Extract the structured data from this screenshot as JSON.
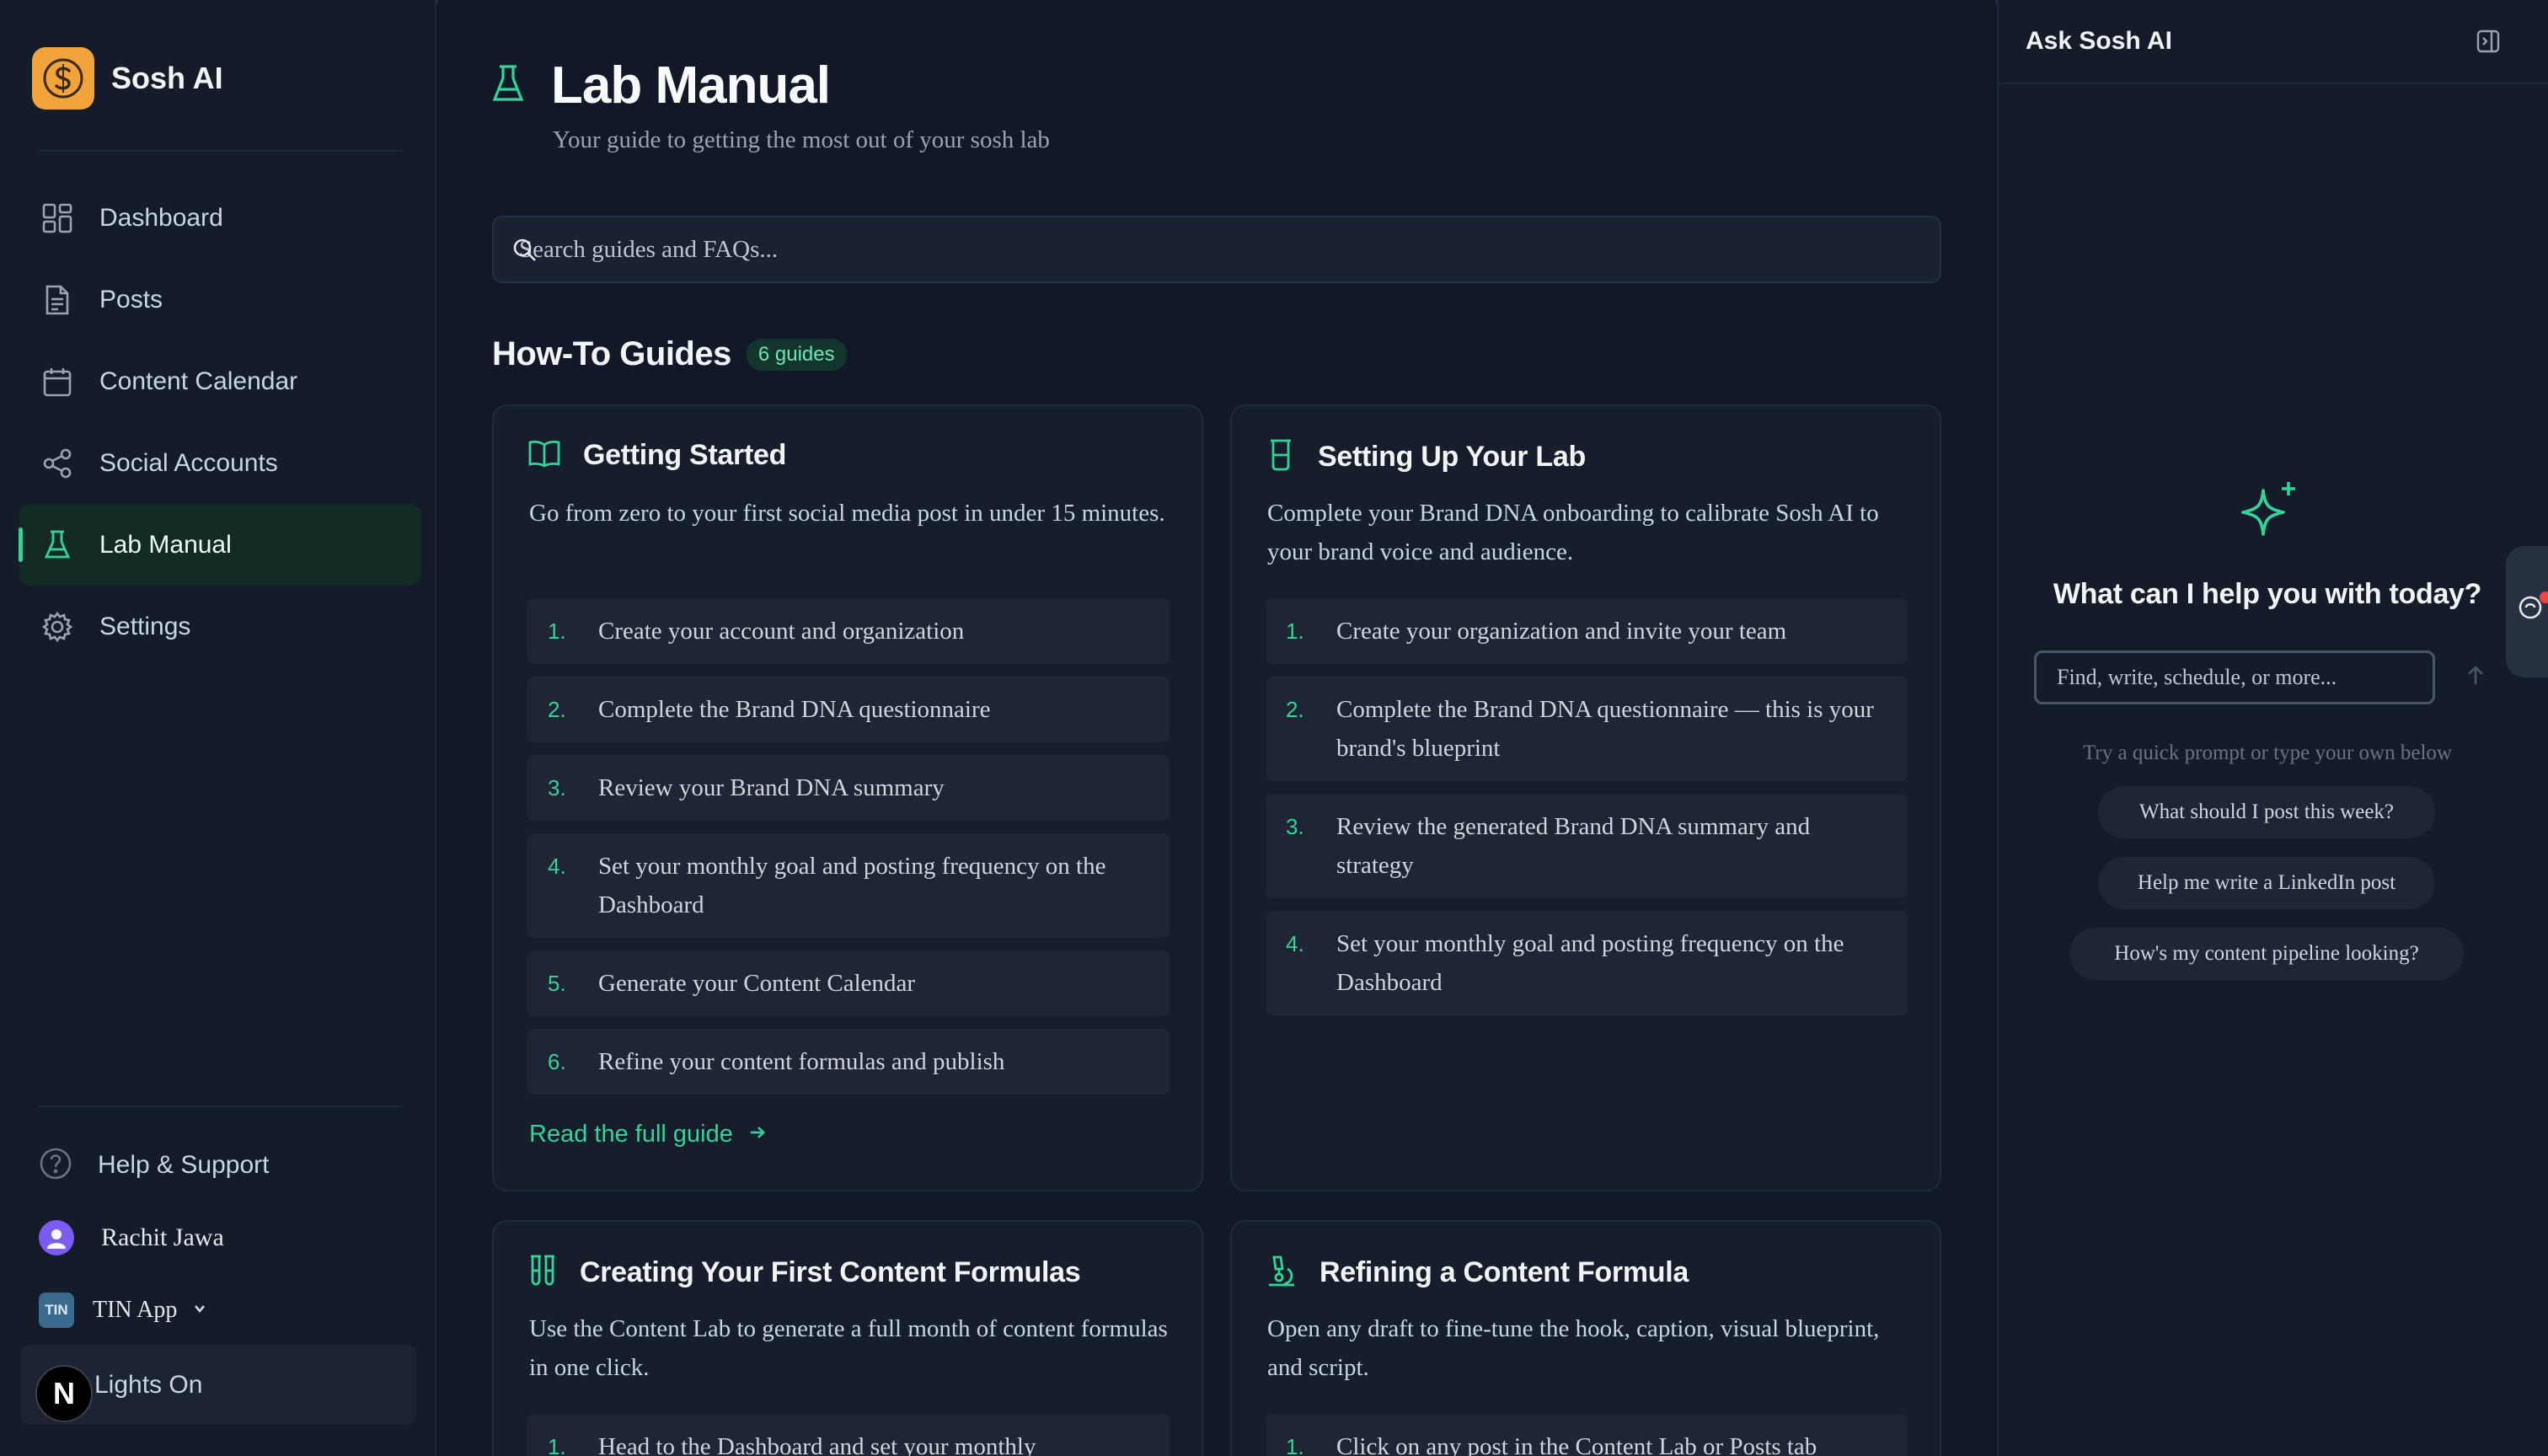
{
  "app": {
    "name": "Sosh AI"
  },
  "sidebar": {
    "nav": [
      {
        "label": "Dashboard",
        "icon": "dashboard-icon"
      },
      {
        "label": "Posts",
        "icon": "document-icon"
      },
      {
        "label": "Content Calendar",
        "icon": "calendar-icon"
      },
      {
        "label": "Social Accounts",
        "icon": "share-icon"
      },
      {
        "label": "Lab Manual",
        "icon": "flask-icon",
        "active": true
      },
      {
        "label": "Settings",
        "icon": "gear-icon"
      }
    ],
    "help_label": "Help & Support",
    "user_name": "Rachit Jawa",
    "org_name": "TIN App",
    "org_logo_text": "TIN",
    "lights_label": "Lights On",
    "n_badge": "N"
  },
  "page": {
    "title": "Lab Manual",
    "subtitle": "Your guide to getting the most out of your sosh lab",
    "search_placeholder": "Search guides and FAQs...",
    "section_title": "How-To Guides",
    "guide_count": "6 guides"
  },
  "guides": [
    {
      "title": "Getting Started",
      "icon": "book-icon",
      "description": "Go from zero to your first social media post in under 15 minutes.",
      "steps": [
        {
          "num": "1.",
          "text": "Create your account and organization"
        },
        {
          "num": "2.",
          "text": "Complete the Brand DNA questionnaire"
        },
        {
          "num": "3.",
          "text": "Review your Brand DNA summary"
        },
        {
          "num": "4.",
          "text": "Set your monthly goal and posting frequency on the Dashboard"
        },
        {
          "num": "5.",
          "text": "Generate your Content Calendar"
        },
        {
          "num": "6.",
          "text": "Refine your content formulas and publish"
        }
      ],
      "link_label": "Read the full guide"
    },
    {
      "title": "Setting Up Your Lab",
      "icon": "beaker-icon",
      "description": "Complete your Brand DNA onboarding to calibrate Sosh AI to your brand voice and audience.",
      "steps": [
        {
          "num": "1.",
          "text": "Create your organization and invite your team"
        },
        {
          "num": "2.",
          "text": "Complete the Brand DNA questionnaire — this is your brand's blueprint"
        },
        {
          "num": "3.",
          "text": "Review the generated Brand DNA summary and strategy"
        },
        {
          "num": "4.",
          "text": "Set your monthly goal and posting frequency on the Dashboard"
        }
      ]
    },
    {
      "title": "Creating Your First Content Formulas",
      "icon": "test-tubes-icon",
      "description": "Use the Content Lab to generate a full month of content formulas in one click.",
      "steps": [
        {
          "num": "1.",
          "text": "Head to the Dashboard and set your monthly"
        }
      ]
    },
    {
      "title": "Refining a Content Formula",
      "icon": "microscope-icon",
      "description": "Open any draft to fine-tune the hook, caption, visual blueprint, and script.",
      "steps": [
        {
          "num": "1.",
          "text": "Click on any post in the Content Lab or Posts tab"
        }
      ]
    }
  ],
  "assistant": {
    "title": "Ask Sosh AI",
    "question": "What can I help you with today?",
    "input_placeholder": "Find, write, schedule, or more...",
    "hint": "Try a quick prompt or type your own below",
    "prompts": [
      "What should I post this week?",
      "Help me write a LinkedIn post",
      "How's my content pipeline looking?"
    ]
  },
  "colors": {
    "accent": "#34d399",
    "background": "#111827",
    "brand_logo": "#f2a43a"
  }
}
